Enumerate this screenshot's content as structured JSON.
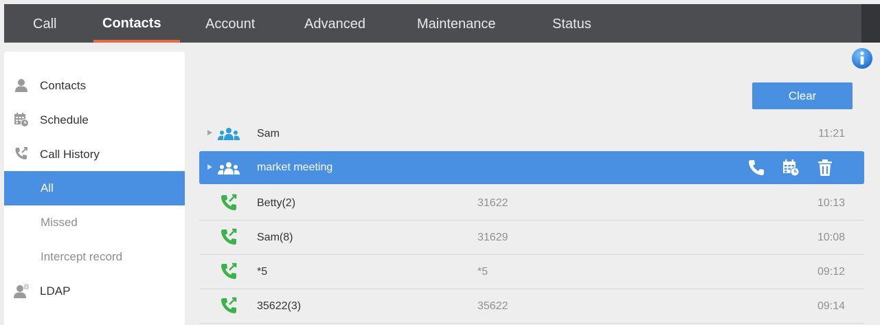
{
  "nav": {
    "items": [
      {
        "label": "Call"
      },
      {
        "label": "Contacts"
      },
      {
        "label": "Account"
      },
      {
        "label": "Advanced"
      },
      {
        "label": "Maintenance"
      },
      {
        "label": "Status"
      }
    ],
    "active": "Contacts"
  },
  "sidebar": {
    "items": [
      {
        "label": "Contacts",
        "icon": "person-icon"
      },
      {
        "label": "Schedule",
        "icon": "calendar-clock-icon"
      },
      {
        "label": "Call History",
        "icon": "phone-arrows-icon"
      },
      {
        "label": "All",
        "selected": true
      },
      {
        "label": "Missed"
      },
      {
        "label": "Intercept record"
      },
      {
        "label": "LDAP",
        "icon": "person-at-icon"
      }
    ]
  },
  "main": {
    "clear_label": "Clear",
    "groups": [
      {
        "name": "Sam",
        "time": "11:21"
      },
      {
        "name": "market meeting",
        "selected": true,
        "actions": [
          "call-icon",
          "schedule-icon",
          "delete-icon"
        ]
      }
    ],
    "calls": [
      {
        "name": "Betty(2)",
        "number": "31622",
        "time": "10:13"
      },
      {
        "name": "Sam(8)",
        "number": "31629",
        "time": "10:08"
      },
      {
        "name": "*5",
        "number": "*5",
        "time": "09:12"
      },
      {
        "name": "35622(3)",
        "number": "35622",
        "time": "09:14"
      }
    ]
  },
  "colors": {
    "nav_bg": "#4b4d51",
    "accent_blue": "#4a90e2",
    "active_underline": "#e86a3a",
    "group_icon": "#2a9fd8",
    "call_icon": "#3bb34a"
  }
}
